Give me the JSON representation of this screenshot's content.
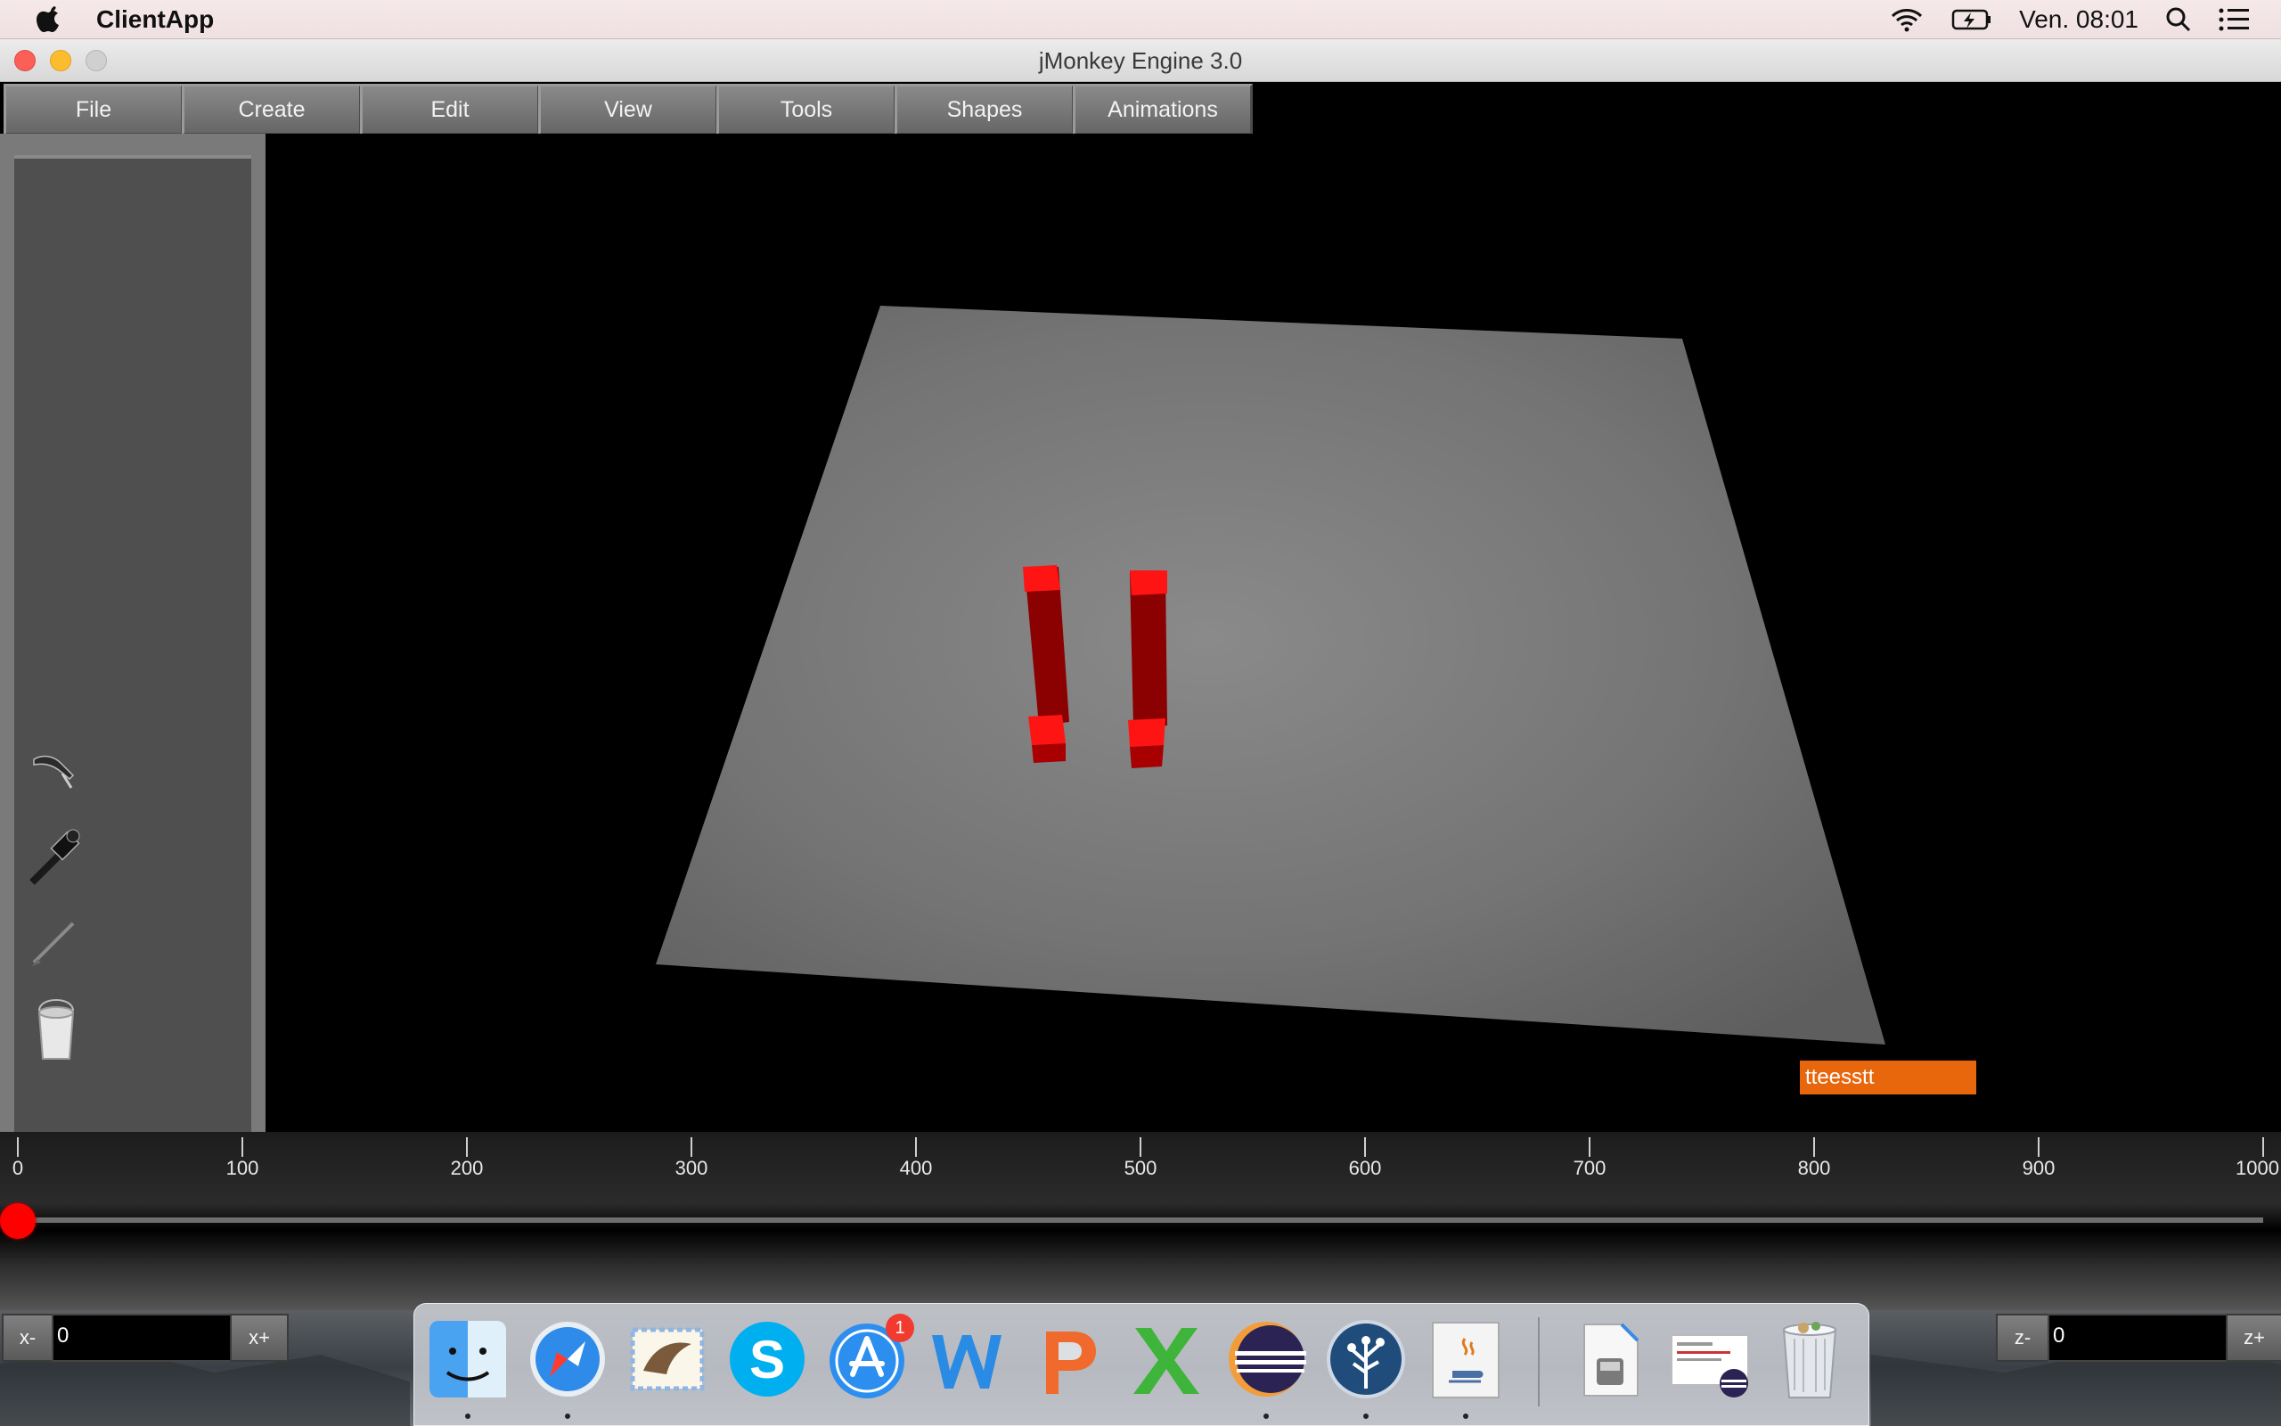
{
  "menubar": {
    "app_name": "ClientApp",
    "clock": "Ven. 08:01",
    "icons": [
      "apple-logo-icon",
      "wifi-icon",
      "battery-charging-icon",
      "spotlight-search-icon",
      "notification-center-icon"
    ]
  },
  "window": {
    "title": "jMonkey Engine 3.0"
  },
  "menus": [
    "File",
    "Create",
    "Edit",
    "View",
    "Tools",
    "Shapes",
    "Animations"
  ],
  "tools": [
    "hand-pick-icon",
    "eyedropper-icon",
    "brush-icon",
    "paint-bucket-icon"
  ],
  "scene": {
    "tag_label": "tteesstt",
    "accent": "#e8660c",
    "object_color": "#ff0000"
  },
  "timeline": {
    "ticks": [
      "0",
      "100",
      "200",
      "300",
      "400",
      "500",
      "600",
      "700",
      "800",
      "900",
      "1000"
    ],
    "playhead_value": 0
  },
  "controls": {
    "x_minus": "x-",
    "x_value": "0",
    "x_plus": "x+",
    "z_minus": "z-",
    "z_value": "0",
    "z_plus": "z+"
  },
  "dock": {
    "apps": [
      "finder-icon",
      "safari-icon",
      "mail-icon",
      "skype-icon",
      "app-store-icon",
      "word-icon",
      "powerpoint-icon",
      "excel-icon",
      "eclipse-icon",
      "sourcetree-icon",
      "java-icon",
      "preview-disk-icon",
      "screenshot-doc-icon",
      "trash-icon"
    ],
    "app_store_badge": "1"
  }
}
